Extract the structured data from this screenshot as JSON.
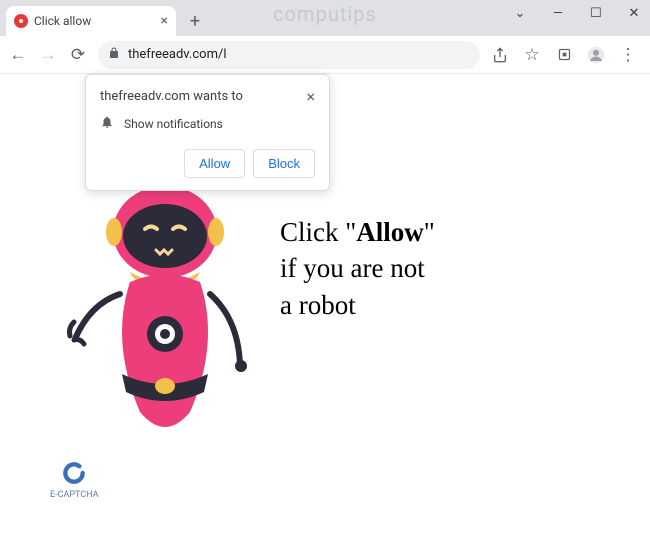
{
  "window": {
    "watermark": "computips"
  },
  "tab": {
    "title": "Click allow"
  },
  "toolbar": {
    "url": "thefreeadv.com/l"
  },
  "popup": {
    "origin": "thefreeadv.com wants to",
    "permission_label": "Show notifications",
    "allow_label": "Allow",
    "block_label": "Block"
  },
  "page": {
    "line1_pre": "Click \"",
    "line1_bold": "Allow",
    "line1_post": "\"",
    "line2": "if you are not",
    "line3": "a robot",
    "captcha_label": "E-CAPTCHA"
  }
}
